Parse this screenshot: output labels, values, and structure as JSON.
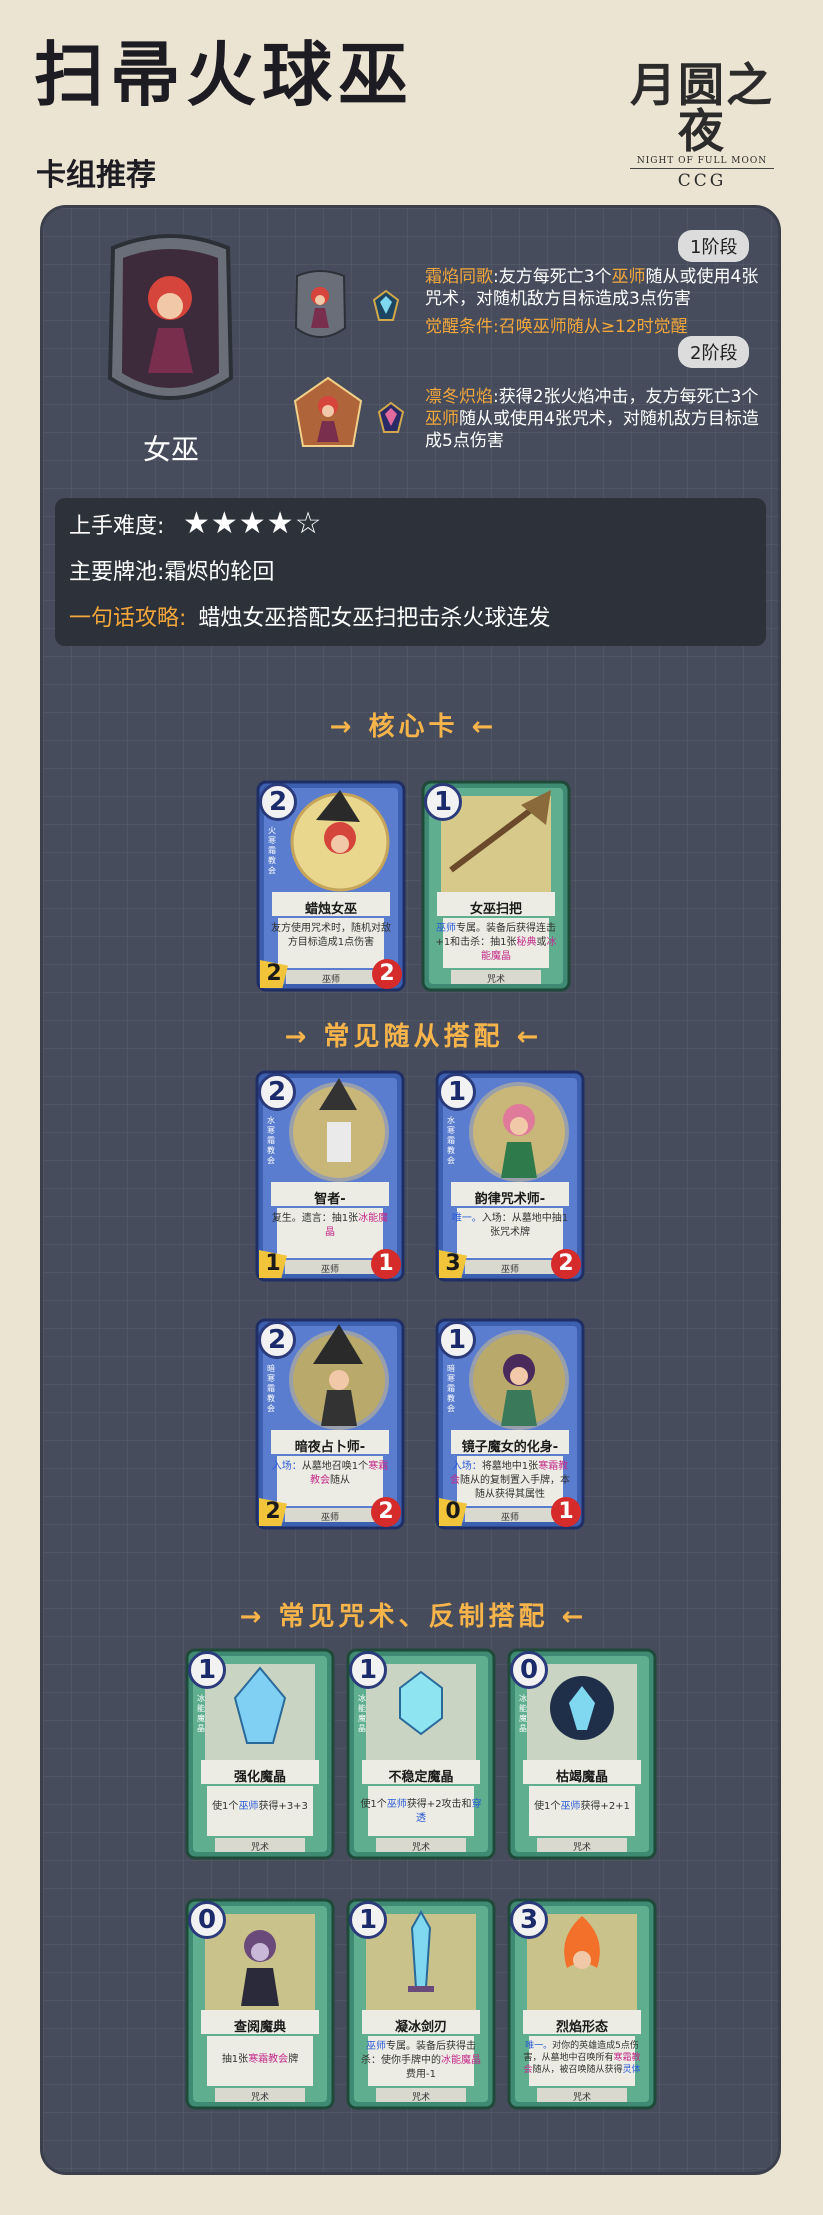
{
  "header": {
    "title": "扫帚火球巫",
    "subtitle": "卡组推荐",
    "logo_main": "月圆之夜",
    "logo_en": "NIGHT OF FULL MOON",
    "logo_ccg": "CCG"
  },
  "hero": {
    "name": "女巫",
    "stage1": {
      "badge": "1阶段",
      "skill": "霜焰同歌",
      "desc_a": ":友方每死亡3个",
      "key": "巫师",
      "desc_b": "随从或使用4张咒术，对随机敌方目标造成3点伤害",
      "awaken": "觉醒条件:召唤巫师随从≥12时觉醒"
    },
    "stage2": {
      "badge": "2阶段",
      "skill": "凛冬炽焰",
      "desc_a": ":获得2张火焰冲击，友方每死亡3个",
      "key": "巫师",
      "desc_b": "随从或使用4张咒术，对随机敌方目标造成5点伤害"
    }
  },
  "info": {
    "difficulty_label": "上手难度:",
    "stars": "★★★★☆",
    "pool_label": "主要牌池:",
    "pool_value": "霜烬的轮回",
    "tip_label": "一句话攻略:",
    "tip_value": "蜡烛女巫搭配女巫扫把击杀火球连发"
  },
  "sections": {
    "core": "→ 核心卡 ←",
    "minions": "→ 常见随从搭配 ←",
    "spells": "→ 常见咒术、反制搭配 ←"
  },
  "cards": {
    "candle_witch": {
      "cost": "2",
      "name": "蜡烛女巫",
      "desc": "友方使用咒术时，随机对敌方目标造成1点伤害",
      "type": "巫师",
      "atk": "2",
      "hp": "2",
      "side": "火 寒霜教会"
    },
    "witch_broom": {
      "cost": "1",
      "name": "女巫扫把",
      "desc_a": "巫师",
      "desc_b": "专属。装备后获得连击+1和击杀：抽1张",
      "desc_k1": "秘典",
      "desc_c": "或",
      "desc_k2": "冰能魔晶",
      "type": "咒术"
    },
    "sage": {
      "cost": "2",
      "name": "智者-",
      "desc_a": "复生。遗言：抽1张",
      "desc_k": "冰能魔晶",
      "type": "巫师",
      "atk": "1",
      "hp": "1",
      "side": "水 寒霜教会"
    },
    "rhythm_caster": {
      "cost": "1",
      "name": "韵律咒术师-",
      "desc_a": "唯一。",
      "desc_b": "入场：从墓地中抽1张咒术牌",
      "type": "巫师",
      "atk": "3",
      "hp": "2",
      "side": "水 寒霜教会"
    },
    "night_seer": {
      "cost": "2",
      "name": "暗夜占卜师-",
      "desc_a": "入场：",
      "desc_b": "从墓地召唤1个",
      "desc_k": "寒霜教会",
      "desc_c": "随从",
      "type": "巫师",
      "atk": "2",
      "hp": "2",
      "side": "暗 寒霜教会"
    },
    "mirror_witch": {
      "cost": "1",
      "name": "镜子魔女的化身-",
      "desc_a": "入场：",
      "desc_b": "将墓地中1张",
      "desc_k": "寒霜教会",
      "desc_c": "随从的复制置入手牌，本随从获得其属性",
      "type": "巫师",
      "atk": "0",
      "hp": "1",
      "side": "暗 寒霜教会"
    },
    "enhanced_crystal": {
      "cost": "1",
      "name": "强化魔晶",
      "desc_a": "使1个",
      "desc_k": "巫师",
      "desc_b": "获得+3+3",
      "type": "咒术",
      "side": "冰能魔晶"
    },
    "unstable_crystal": {
      "cost": "1",
      "name": "不稳定魔晶",
      "desc_a": "使1个",
      "desc_k": "巫师",
      "desc_b": "获得+2攻击和",
      "desc_k2": "穿透",
      "type": "咒术",
      "side": "冰能魔晶"
    },
    "dry_crystal": {
      "cost": "0",
      "name": "枯竭魔晶",
      "desc_a": "使1个",
      "desc_k": "巫师",
      "desc_b": "获得+2+1",
      "type": "咒术",
      "side": "冰能魔晶"
    },
    "read_codex": {
      "cost": "0",
      "name": "查阅魔典",
      "desc_a": "抽1张",
      "desc_k": "寒霜教会",
      "desc_b": "牌",
      "type": "咒术"
    },
    "ice_blade": {
      "cost": "1",
      "name": "凝冰剑刃",
      "desc_a": "巫师",
      "desc_b": "专属。装备后获得击杀：使你手牌中的",
      "desc_k": "冰能魔晶",
      "desc_c": "费用-1",
      "type": "咒术"
    },
    "flame_form": {
      "cost": "3",
      "name": "烈焰形态",
      "desc_a": "唯一。",
      "desc_b": "对你的英雄造成5点伤害，从墓地中召唤所有",
      "desc_k": "寒霜教会",
      "desc_c": "随从，被召唤随从获得",
      "desc_k2": "灵体",
      "type": "咒术"
    }
  }
}
